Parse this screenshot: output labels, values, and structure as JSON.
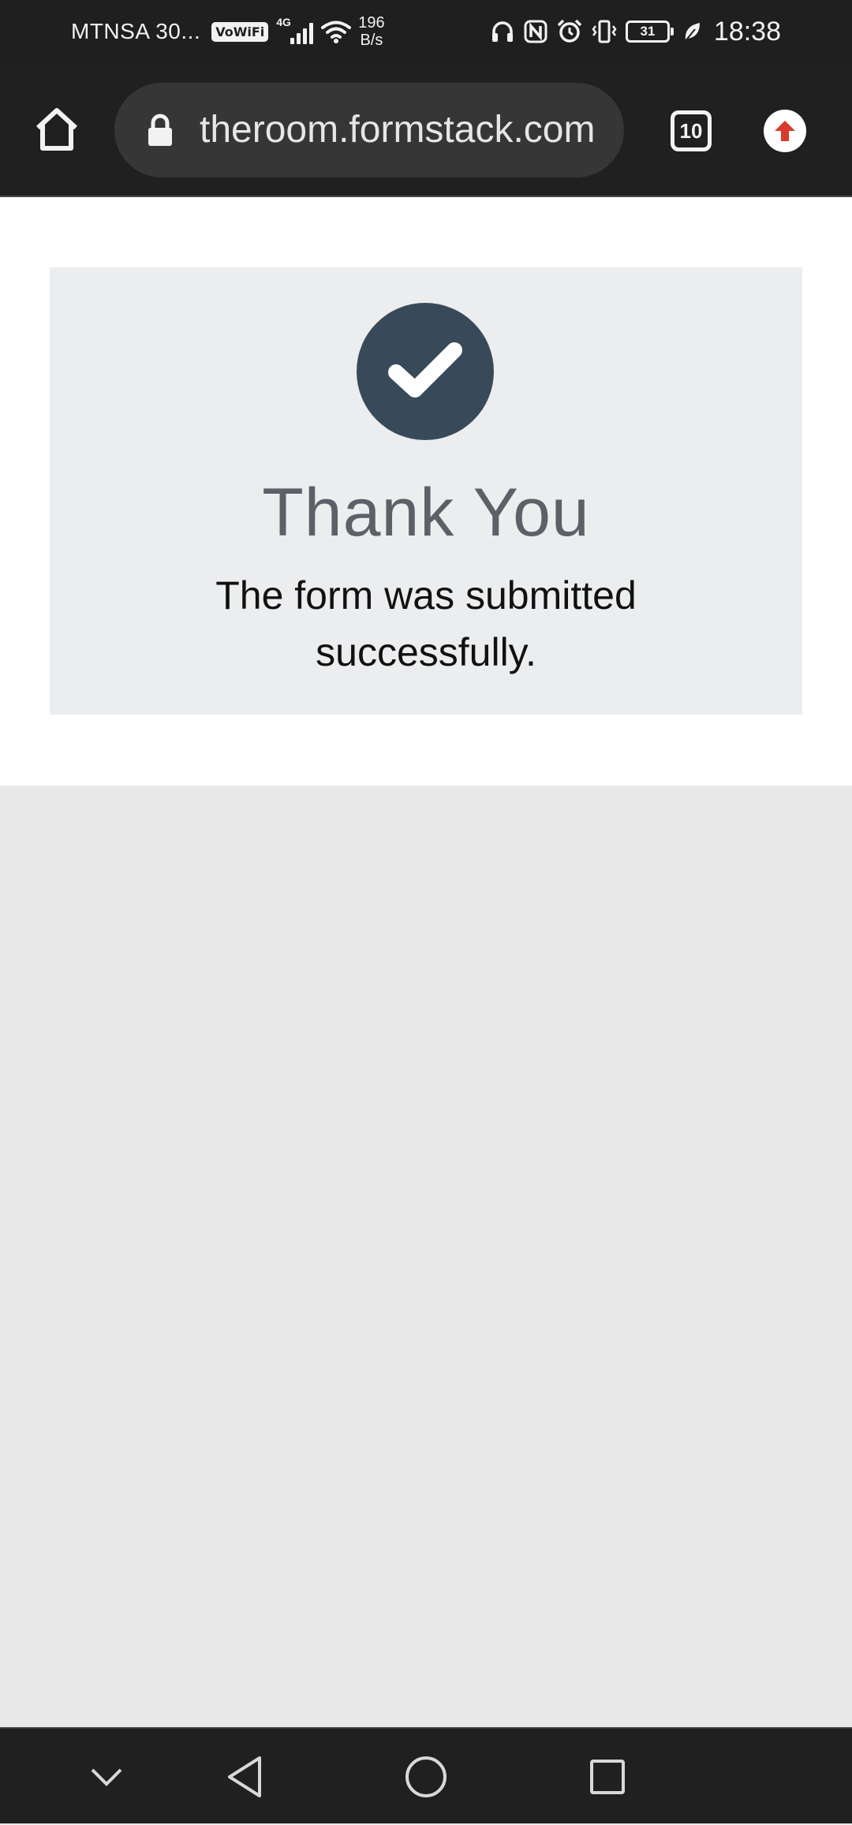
{
  "status_bar": {
    "carrier": "MTNSA 30...",
    "vowifi_badge": "VoWiFi",
    "network_type": "4G",
    "speed_value": "196",
    "speed_unit": "B/s",
    "battery_level": "31",
    "time": "18:38",
    "icons": [
      "signal-icon",
      "wifi-icon",
      "headphones-icon",
      "nfc-icon",
      "alarm-icon",
      "vibrate-icon",
      "battery-icon",
      "battery-saver-leaf-icon"
    ]
  },
  "browser": {
    "url": "theroom.formstack.com",
    "tab_count": "10",
    "icons": [
      "home-icon",
      "lock-icon",
      "tabs-icon",
      "update-arrow-icon"
    ],
    "update_color": "#d93b2b"
  },
  "confirmation": {
    "title": "Thank You",
    "message": "The form was submitted successfully.",
    "icon": "checkmark-circle-icon",
    "accent_color": "#384a59"
  },
  "nav_bar": {
    "icons": [
      "hide-chevron-icon",
      "back-icon",
      "home-circle-icon",
      "recents-icon"
    ]
  }
}
